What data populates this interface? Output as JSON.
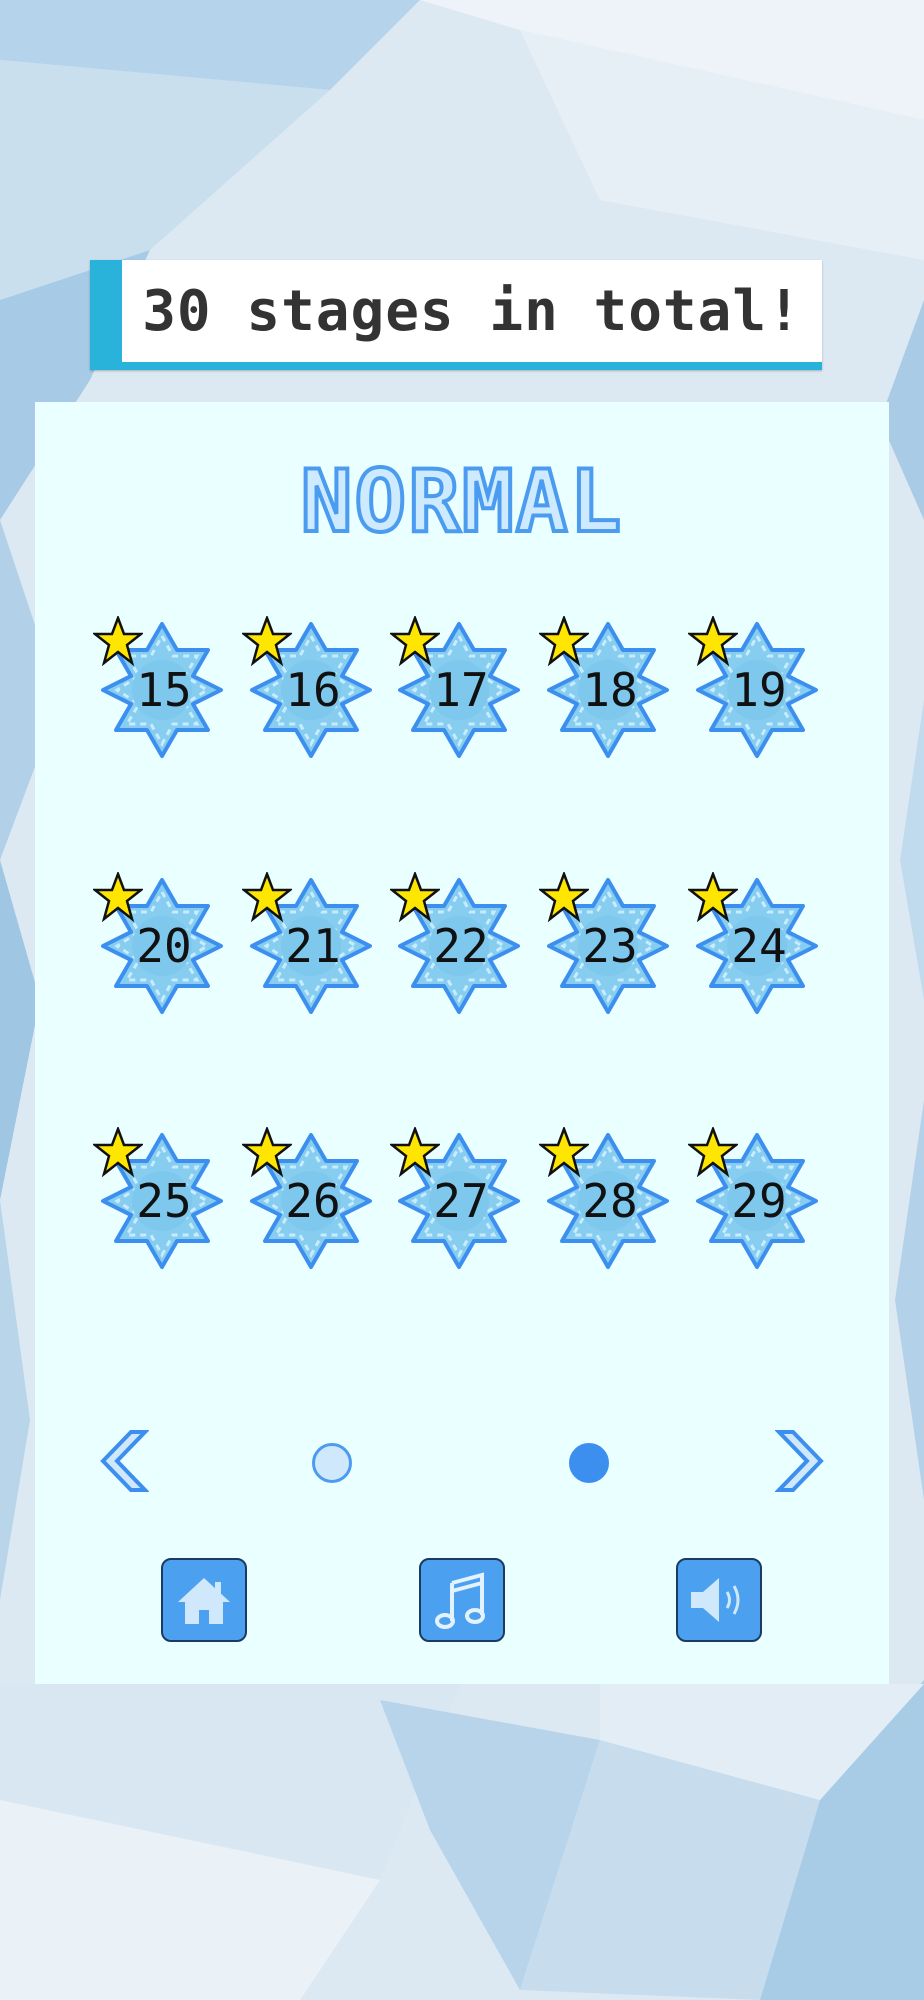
{
  "banner": {
    "text": "30 stages in total!",
    "accent_color": "#29b3da"
  },
  "difficulty": {
    "label": "NORMAL"
  },
  "stages": [
    {
      "number": "15",
      "starred": true
    },
    {
      "number": "16",
      "starred": true
    },
    {
      "number": "17",
      "starred": true
    },
    {
      "number": "18",
      "starred": true
    },
    {
      "number": "19",
      "starred": true
    },
    {
      "number": "20",
      "starred": true
    },
    {
      "number": "21",
      "starred": true
    },
    {
      "number": "22",
      "starred": true
    },
    {
      "number": "23",
      "starred": true
    },
    {
      "number": "24",
      "starred": true
    },
    {
      "number": "25",
      "starred": true
    },
    {
      "number": "26",
      "starred": true
    },
    {
      "number": "27",
      "starred": true
    },
    {
      "number": "28",
      "starred": true
    },
    {
      "number": "29",
      "starred": true
    }
  ],
  "pagination": {
    "total_pages": 2,
    "current_page": 2
  },
  "icons": {
    "prev": "chevron-left-icon",
    "next": "chevron-right-icon",
    "home": "home-icon",
    "music": "music-note-icon",
    "sound": "speaker-icon",
    "stage": "snowflake-icon",
    "cleared": "star-icon"
  },
  "colors": {
    "panel": "#eaffff",
    "button": "#4ba1ef",
    "star": "#ffe600",
    "flake": "#86cdf0"
  }
}
